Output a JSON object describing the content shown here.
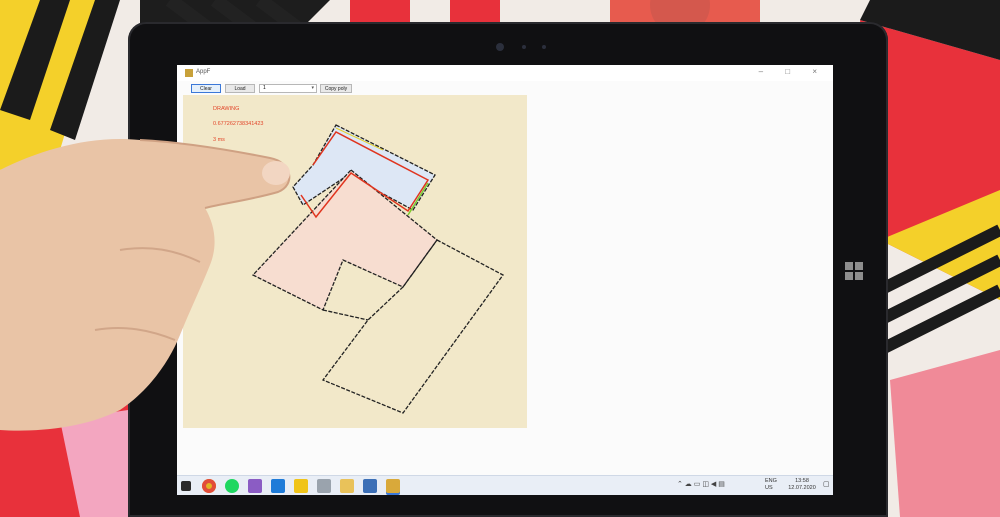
{
  "window": {
    "title": "AppF",
    "controls": "– □ ×"
  },
  "toolbar": {
    "clear_label": "Clear",
    "load_label": "Load",
    "combo_value": "1",
    "copy_label": "Copy poly"
  },
  "canvas": {
    "status_line1": "DRAWING",
    "status_line2": "0.677262738341423",
    "status_line3": "3 ms"
  },
  "taskbar": {
    "language": "ENG",
    "region": "US",
    "time": "13:58",
    "date": "12.07.2020",
    "icons": [
      "start-icon",
      "chrome-icon",
      "spotify-icon",
      "visual-studio-icon",
      "vscode-icon",
      "app-icon-5",
      "app-icon-6",
      "file-explorer-icon",
      "app-icon-8",
      "app-icon-9"
    ]
  },
  "colors": {
    "canvas_bg": "#f2e8c9",
    "blue_fill": "#dde7f5",
    "pink_fill": "#f7ddd0",
    "status_text": "#e2462a",
    "outline_red": "#e0341e",
    "outline_green": "#7ecb2a"
  }
}
